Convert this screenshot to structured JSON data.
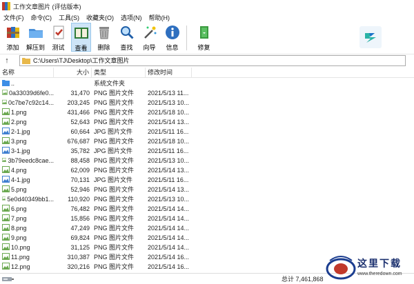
{
  "window": {
    "title": "工作文章图片 (评估版本)"
  },
  "menu": [
    "文件(F)",
    "命令(C)",
    "工具(S)",
    "收藏夹(O)",
    "选项(N)",
    "帮助(H)"
  ],
  "toolbar": [
    {
      "label": "添加",
      "icon": "add-archive-icon"
    },
    {
      "label": "解压到",
      "icon": "extract-to-icon"
    },
    {
      "label": "测试",
      "icon": "test-icon"
    },
    {
      "label": "查看",
      "icon": "view-book-icon"
    },
    {
      "label": "删除",
      "icon": "delete-trash-icon"
    },
    {
      "label": "查找",
      "icon": "find-magnifier-icon"
    },
    {
      "label": "向导",
      "icon": "wizard-wand-icon"
    },
    {
      "label": "信息",
      "icon": "info-icon"
    },
    {
      "label": "修复",
      "icon": "repair-icon"
    }
  ],
  "address": {
    "path": "C:\\Users\\TJ\\Desktop\\工作文章图片"
  },
  "columns": {
    "name": "名称",
    "size": "大小",
    "type": "类型",
    "date": "修改时间"
  },
  "files": [
    {
      "name": "..",
      "size": "",
      "type": "系统文件夹",
      "date": "",
      "kind": "folder"
    },
    {
      "name": "0a33039d6fe0...",
      "size": "31,470",
      "type": "PNG 图片文件",
      "date": "2021/5/13 11...",
      "kind": "png"
    },
    {
      "name": "0c7be7c92c14...",
      "size": "203,245",
      "type": "PNG 图片文件",
      "date": "2021/5/13 10...",
      "kind": "png"
    },
    {
      "name": "1.png",
      "size": "431,466",
      "type": "PNG 图片文件",
      "date": "2021/5/18 10...",
      "kind": "png"
    },
    {
      "name": "2.png",
      "size": "52,643",
      "type": "PNG 图片文件",
      "date": "2021/5/14 13...",
      "kind": "png"
    },
    {
      "name": "2-1.jpg",
      "size": "60,664",
      "type": "JPG 图片文件",
      "date": "2021/5/11 16...",
      "kind": "jpg"
    },
    {
      "name": "3.png",
      "size": "676,687",
      "type": "PNG 图片文件",
      "date": "2021/5/18 10...",
      "kind": "png"
    },
    {
      "name": "3-1.jpg",
      "size": "35,782",
      "type": "JPG 图片文件",
      "date": "2021/5/11 16...",
      "kind": "jpg"
    },
    {
      "name": "3b79eedc8cae...",
      "size": "88,458",
      "type": "PNG 图片文件",
      "date": "2021/5/13 10...",
      "kind": "png"
    },
    {
      "name": "4.png",
      "size": "62,009",
      "type": "PNG 图片文件",
      "date": "2021/5/14 13...",
      "kind": "png"
    },
    {
      "name": "4-1.jpg",
      "size": "70,131",
      "type": "JPG 图片文件",
      "date": "2021/5/11 16...",
      "kind": "jpg"
    },
    {
      "name": "5.png",
      "size": "52,946",
      "type": "PNG 图片文件",
      "date": "2021/5/14 13...",
      "kind": "png"
    },
    {
      "name": "5e0d40349bb1...",
      "size": "110,920",
      "type": "PNG 图片文件",
      "date": "2021/5/13 10...",
      "kind": "png"
    },
    {
      "name": "6.png",
      "size": "76,482",
      "type": "PNG 图片文件",
      "date": "2021/5/14 14...",
      "kind": "png"
    },
    {
      "name": "7.png",
      "size": "15,856",
      "type": "PNG 图片文件",
      "date": "2021/5/14 14...",
      "kind": "png"
    },
    {
      "name": "8.png",
      "size": "47,249",
      "type": "PNG 图片文件",
      "date": "2021/5/14 14...",
      "kind": "png"
    },
    {
      "name": "9.png",
      "size": "69,824",
      "type": "PNG 图片文件",
      "date": "2021/5/14 14...",
      "kind": "png"
    },
    {
      "name": "10.png",
      "size": "31,125",
      "type": "PNG 图片文件",
      "date": "2021/5/14 14...",
      "kind": "png"
    },
    {
      "name": "11.png",
      "size": "310,387",
      "type": "PNG 图片文件",
      "date": "2021/5/14 16...",
      "kind": "png"
    },
    {
      "name": "12.png",
      "size": "320,216",
      "type": "PNG 图片文件",
      "date": "2021/5/14 16...",
      "kind": "png"
    }
  ],
  "status": {
    "total": "总计 7,461,868"
  },
  "watermark": {
    "name": "这里下载",
    "url": "www.theredown.com"
  },
  "colors": {
    "png_icon": "#6aa84f",
    "jpg_icon": "#3f7fd0",
    "folder": "#3d8ee6",
    "active_bg": "#cde4f7"
  }
}
